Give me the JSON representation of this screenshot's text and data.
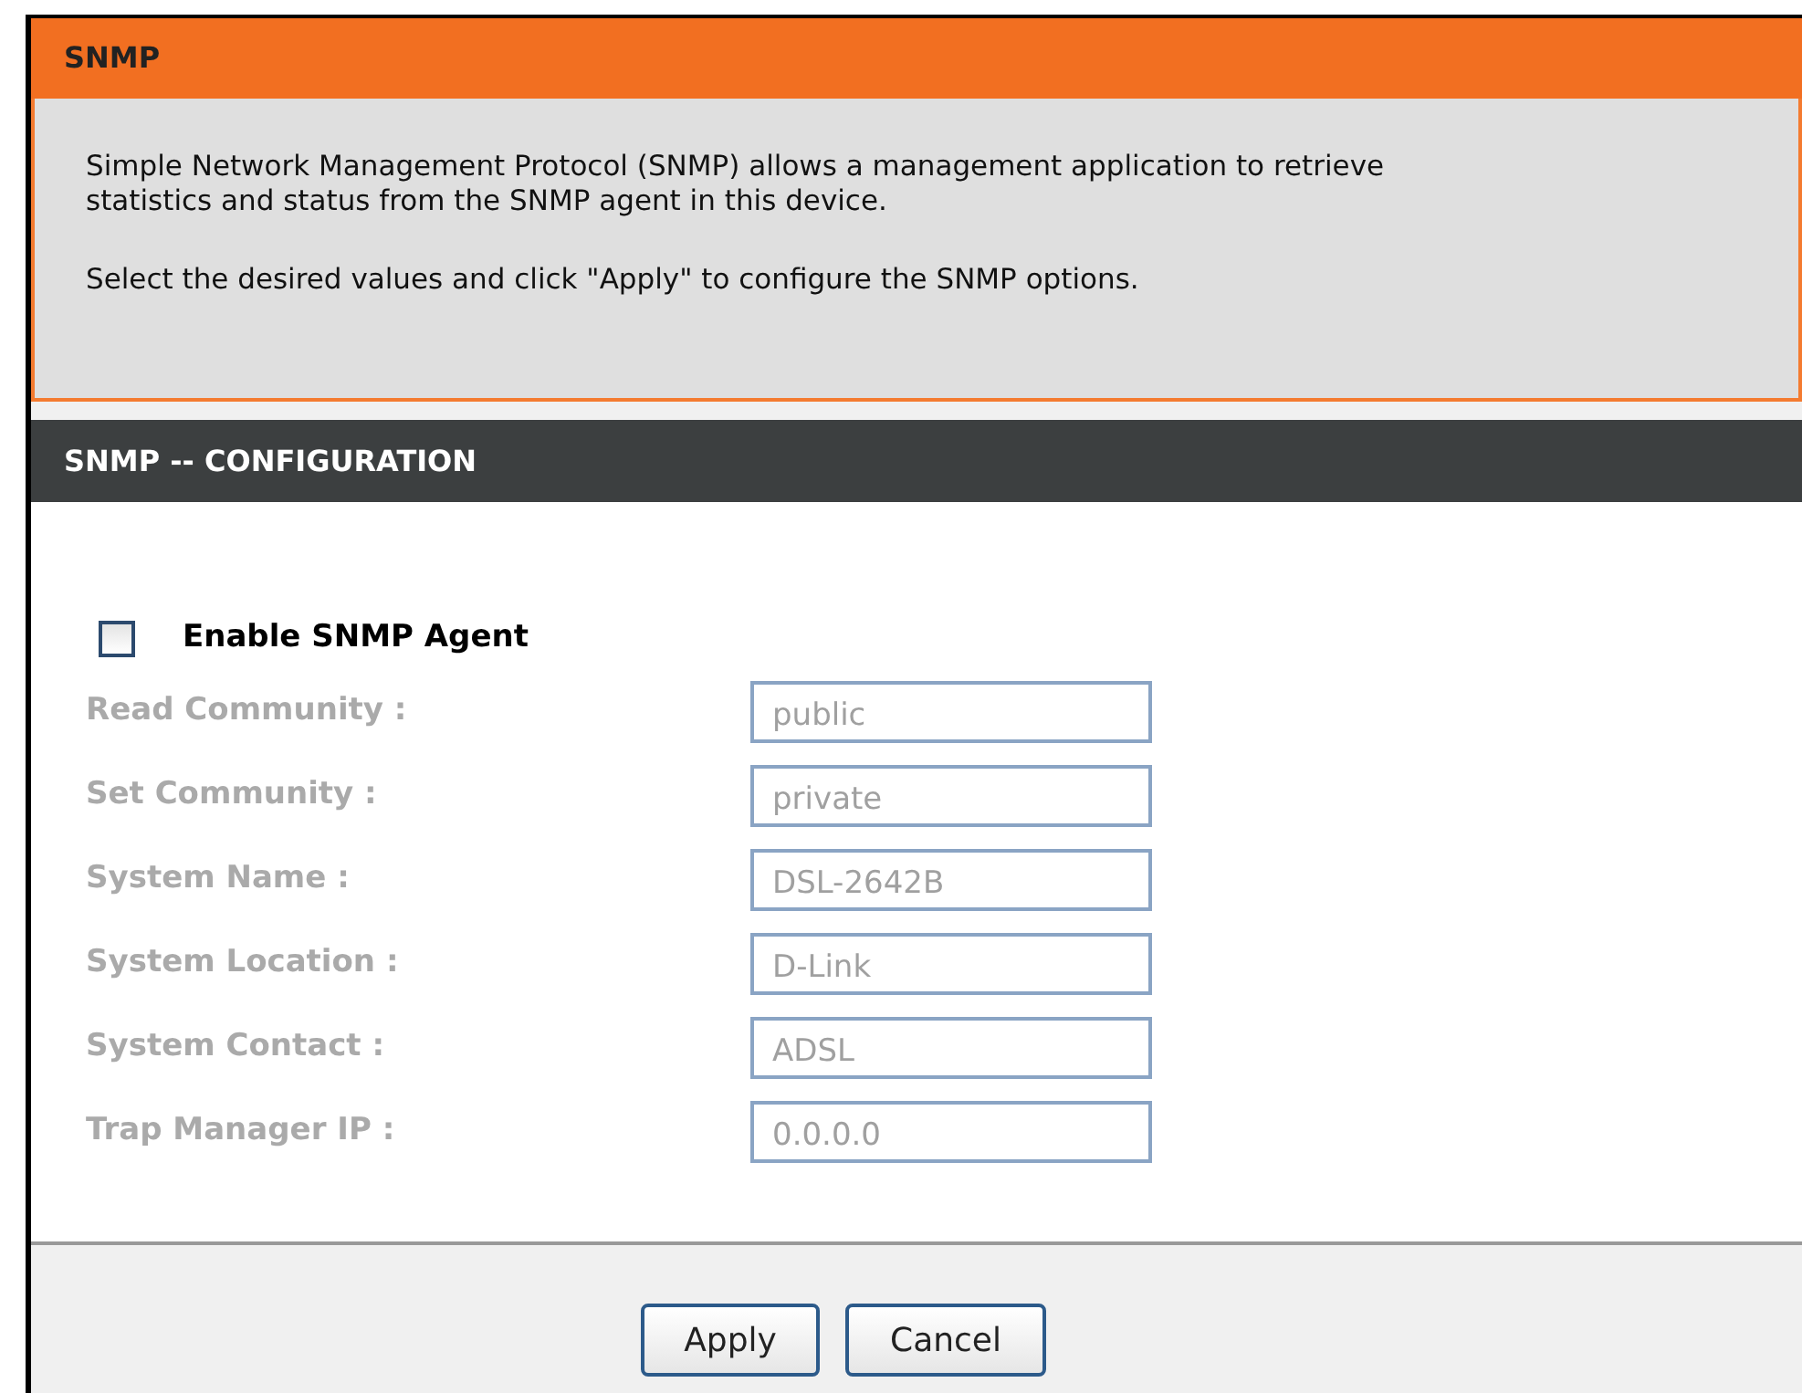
{
  "section": {
    "title": "SNMP",
    "paragraphs": [
      "Simple Network Management Protocol (SNMP) allows a management application to retrieve statistics and status from the SNMP agent in this device.",
      "Select the desired values and click \"Apply\" to configure the SNMP options."
    ]
  },
  "configuration": {
    "title": "SNMP -- CONFIGURATION",
    "enable": {
      "label": "Enable SNMP Agent",
      "checked": false
    },
    "fields": [
      {
        "label": "Read Community :",
        "value": "public",
        "disabled": true
      },
      {
        "label": "Set Community :",
        "value": "private",
        "disabled": true
      },
      {
        "label": "System Name :",
        "value": "DSL-2642B",
        "disabled": true
      },
      {
        "label": "System Location :",
        "value": "D-Link",
        "disabled": true
      },
      {
        "label": "System Contact :",
        "value": "ADSL",
        "disabled": true
      },
      {
        "label": "Trap Manager IP :",
        "value": "0.0.0.0",
        "disabled": true
      }
    ]
  },
  "buttons": [
    "Apply",
    "Cancel"
  ]
}
